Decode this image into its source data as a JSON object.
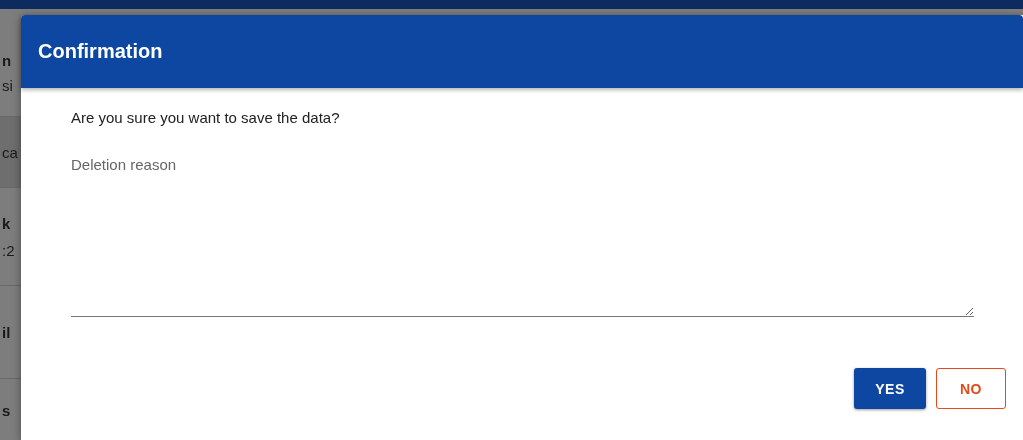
{
  "background": {
    "fragments": [
      {
        "text": "n",
        "bold": true
      },
      {
        "text": "si",
        "bold": false
      },
      {
        "text": "ca",
        "bold": false
      },
      {
        "text": "k",
        "bold": true
      },
      {
        "text": ":2",
        "bold": false
      },
      {
        "text": "il",
        "bold": true
      },
      {
        "text": "s",
        "bold": true
      }
    ]
  },
  "dialog": {
    "title": "Confirmation",
    "message": "Are you sure you want to save the data?",
    "reason_field": {
      "placeholder": "Deletion reason"
    },
    "buttons": [
      {
        "label": "YES",
        "kind": "primary"
      },
      {
        "label": "NO",
        "kind": "outlined"
      }
    ]
  }
}
